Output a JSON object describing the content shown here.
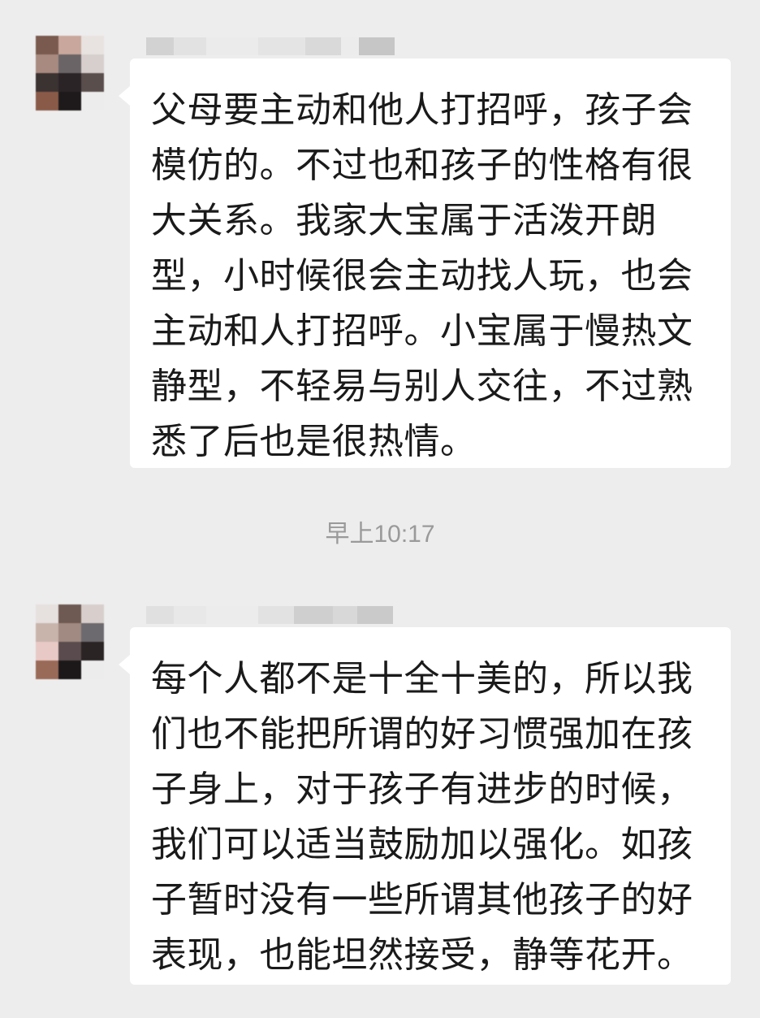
{
  "chat": {
    "messages": [
      {
        "sender_name": "",
        "text": "父母要主动和他人打招呼，孩子会模仿的。不过也和孩子的性格有很大关系。我家大宝属于活泼开朗型，小时候很会主动找人玩，也会主动和人打招呼。小宝属于慢热文静型，不轻易与别人交往，不过熟悉了后也是很热情。"
      },
      {
        "sender_name": "",
        "text": "每个人都不是十全十美的，所以我们也不能把所谓的好习惯强加在孩子身上，对于孩子有进步的时候，我们可以适当鼓励加以强化。如孩子暂时没有一些所谓其他孩子的好表现，也能坦然接受，静等花开。"
      }
    ],
    "timestamp": "早上10:17"
  },
  "colors": {
    "background": "#ededed",
    "bubble": "#ffffff",
    "text": "#1a1a1a",
    "timestamp": "#9a9a9a"
  }
}
